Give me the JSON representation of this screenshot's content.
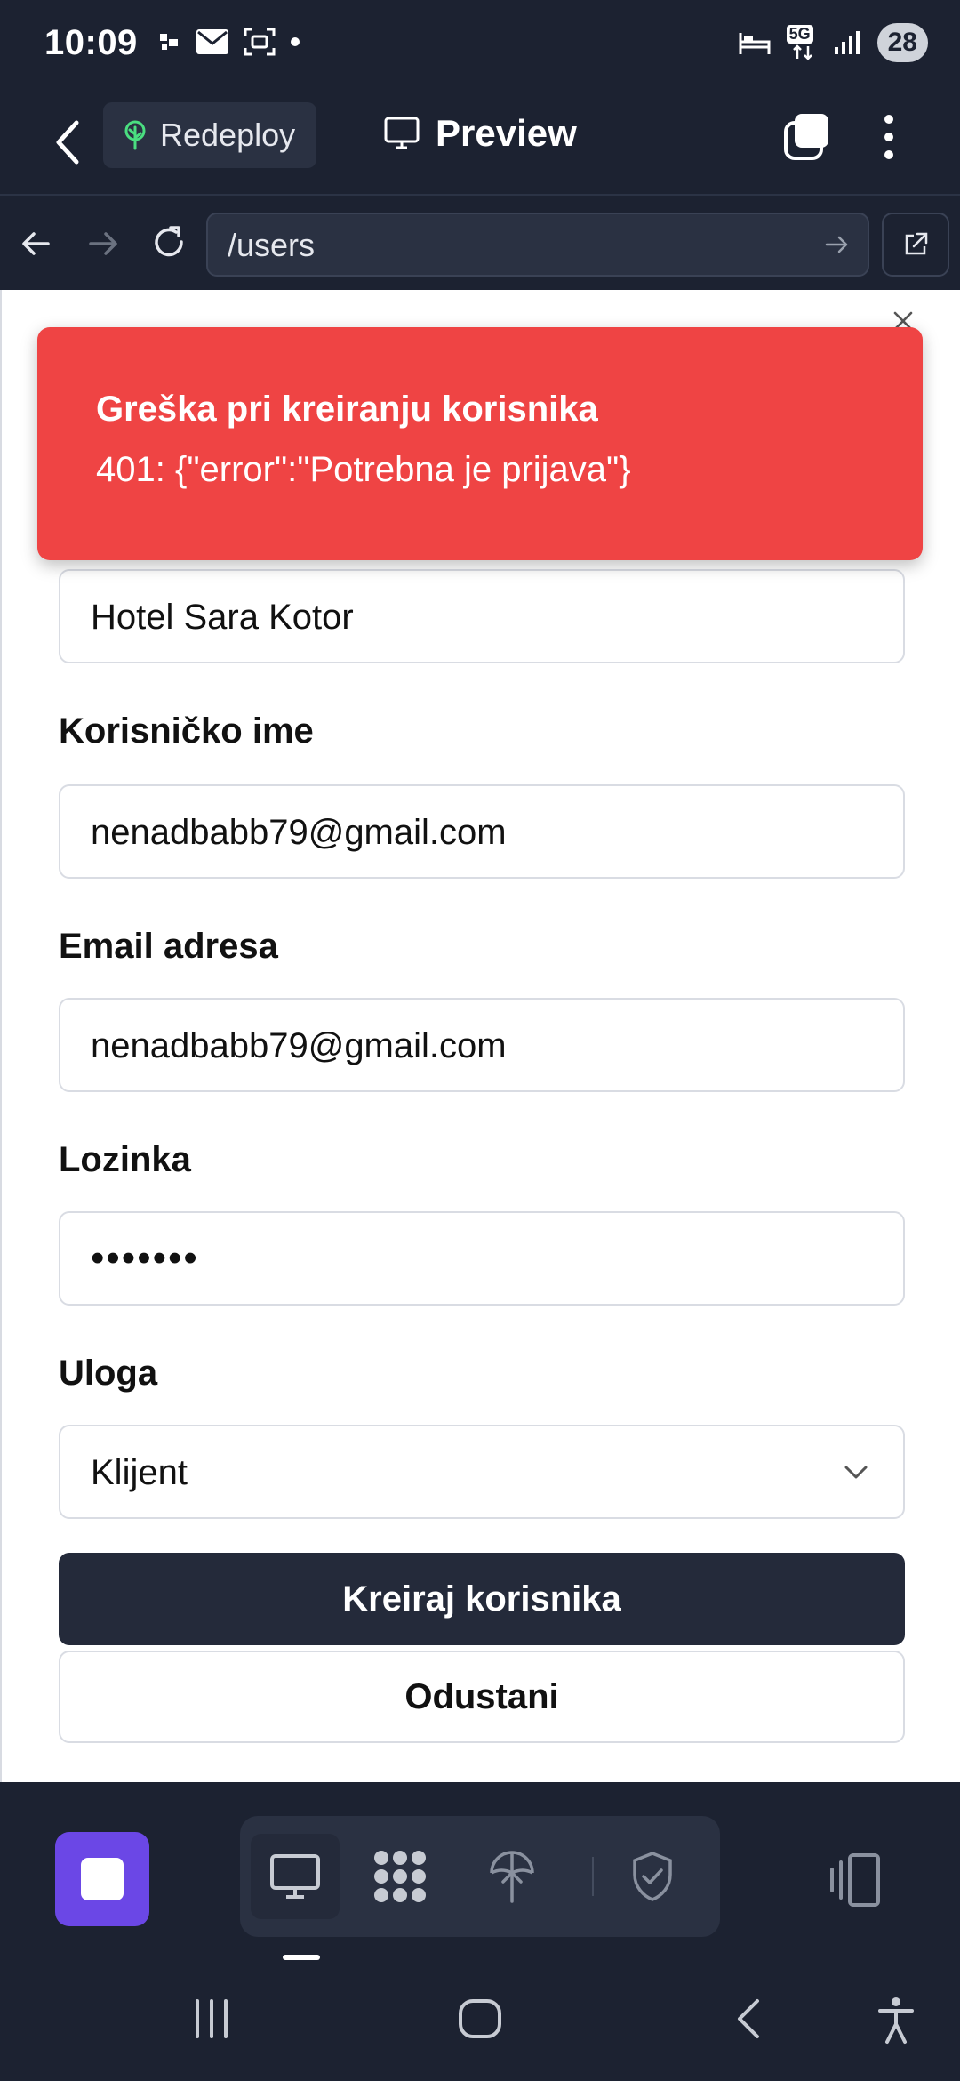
{
  "status_bar": {
    "time": "10:09",
    "network": "5G",
    "battery": "28"
  },
  "app_bar": {
    "redeploy_label": "Redeploy",
    "preview_label": "Preview"
  },
  "url_bar": {
    "url": "/users"
  },
  "toast": {
    "title": "Greška pri kreiranju korisnika",
    "message": "401: {\"error\":\"Potrebna je prijava\"}",
    "color": "#ef4444"
  },
  "form": {
    "hotel_value": "Hotel Sara Kotor",
    "username_label": "Korisničko ime",
    "username_value": "nenadbabb79@gmail.com",
    "email_label": "Email adresa",
    "email_value": "nenadbabb79@gmail.com",
    "password_label": "Lozinka",
    "password_value": "•••••••",
    "role_label": "Uloga",
    "role_value": "Klijent",
    "submit_label": "Kreiraj korisnika",
    "cancel_label": "Odustani"
  },
  "toolbar": {
    "accent_color": "#6b47e6",
    "items": [
      "desktop-icon",
      "modules-icon",
      "deploy-icon",
      "shield-check-icon"
    ]
  }
}
